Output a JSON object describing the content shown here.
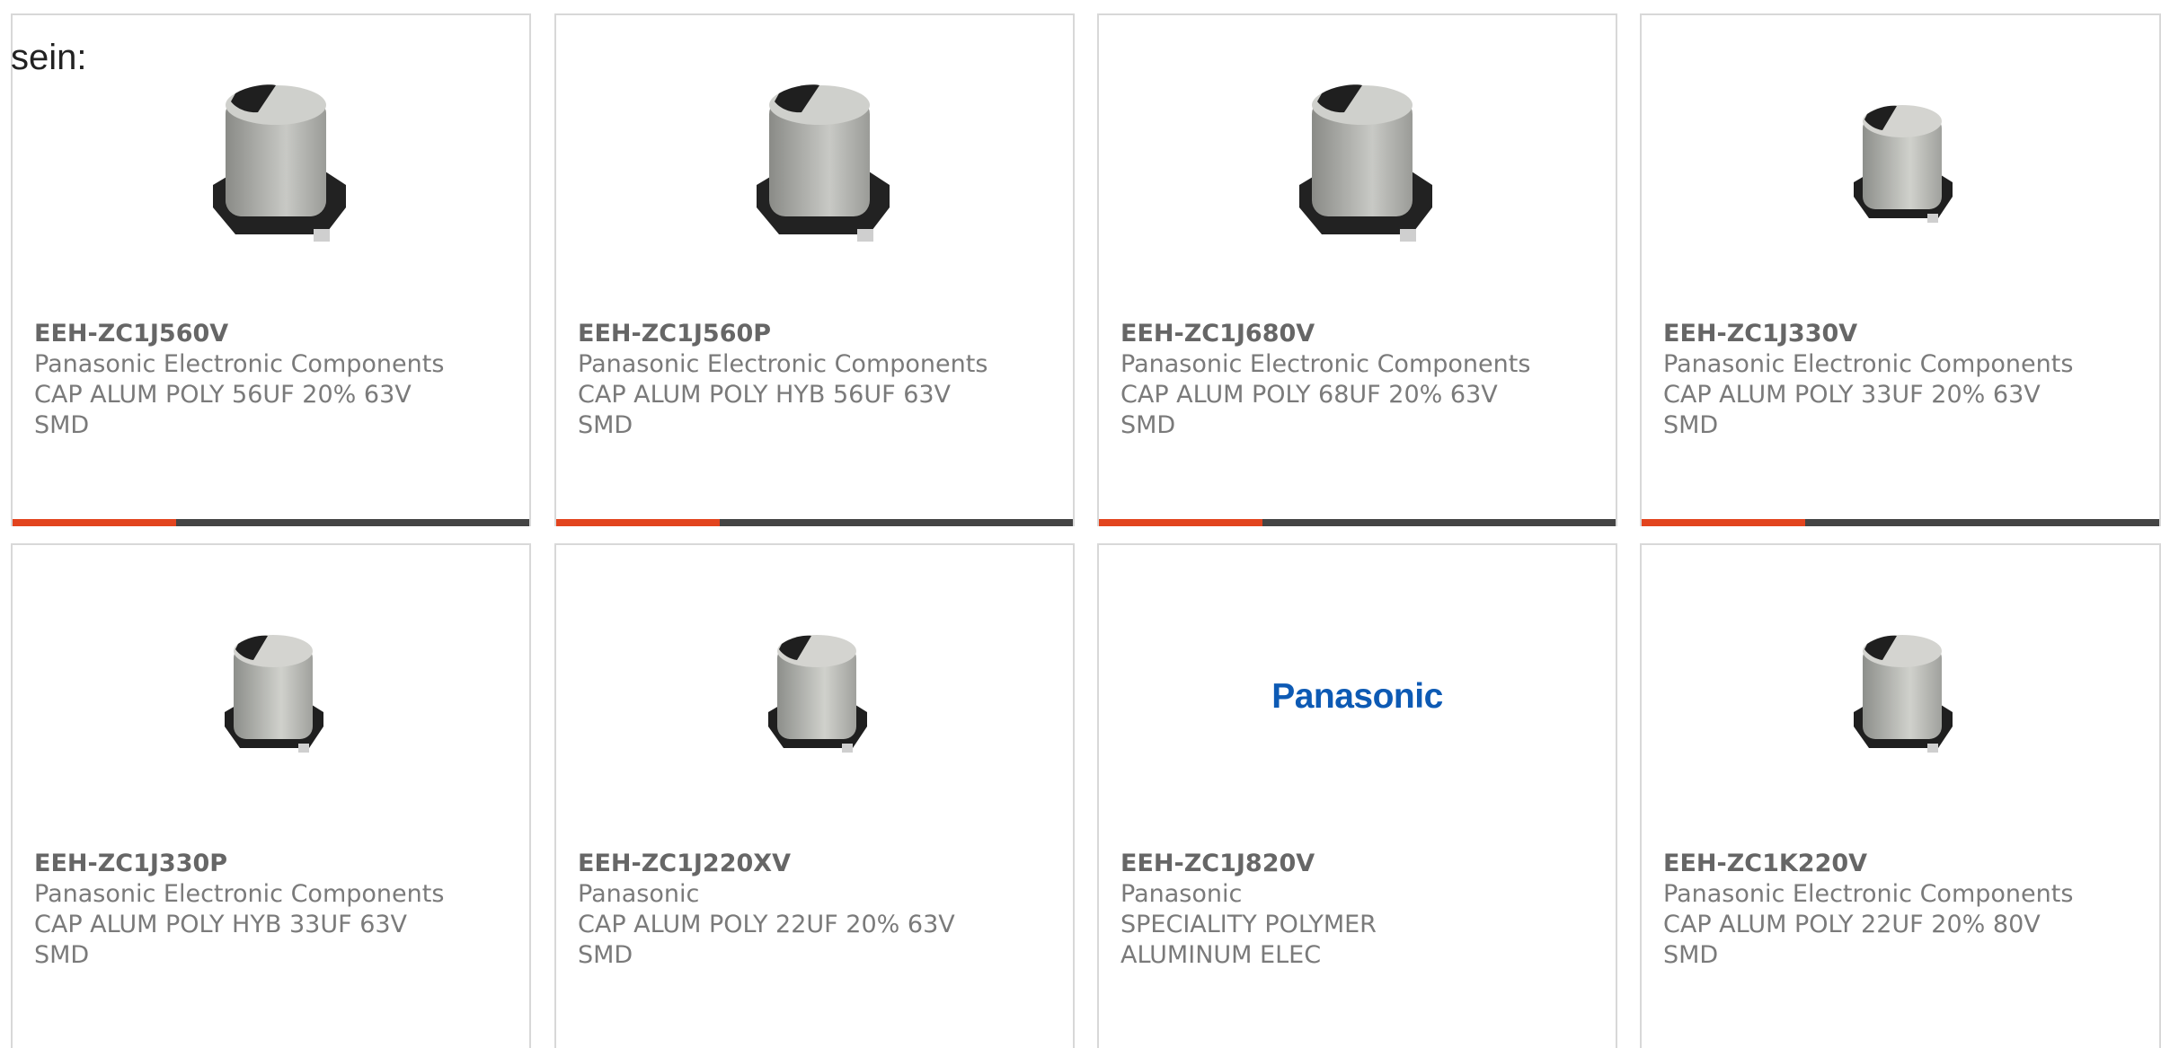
{
  "intro_text": "sein:",
  "products": [
    {
      "part_number": "EEH-ZC1J560V",
      "manufacturer": "Panasonic Electronic Components",
      "description_line_1": "CAP ALUM POLY 56UF 20% 63V",
      "description_line_2": "SMD",
      "image_kind": "capacitor-large",
      "has_accent_bar": true
    },
    {
      "part_number": "EEH-ZC1J560P",
      "manufacturer": "Panasonic Electronic Components",
      "description_line_1": "CAP ALUM POLY HYB 56UF 63V",
      "description_line_2": "SMD",
      "image_kind": "capacitor-large",
      "has_accent_bar": true
    },
    {
      "part_number": "EEH-ZC1J680V",
      "manufacturer": "Panasonic Electronic Components",
      "description_line_1": "CAP ALUM POLY 68UF 20% 63V",
      "description_line_2": "SMD",
      "image_kind": "capacitor-large",
      "has_accent_bar": true
    },
    {
      "part_number": "EEH-ZC1J330V",
      "manufacturer": "Panasonic Electronic Components",
      "description_line_1": "CAP ALUM POLY 33UF 20% 63V",
      "description_line_2": "SMD",
      "image_kind": "capacitor-small",
      "has_accent_bar": true
    },
    {
      "part_number": "EEH-ZC1J330P",
      "manufacturer": "Panasonic Electronic Components",
      "description_line_1": "CAP ALUM POLY HYB 33UF 63V",
      "description_line_2": "SMD",
      "image_kind": "capacitor-small",
      "has_accent_bar": false
    },
    {
      "part_number": "EEH-ZC1J220XV",
      "manufacturer": "Panasonic",
      "description_line_1": "CAP ALUM POLY 22UF 20% 63V",
      "description_line_2": "SMD",
      "image_kind": "capacitor-small",
      "has_accent_bar": false
    },
    {
      "part_number": "EEH-ZC1J820V",
      "manufacturer": "Panasonic",
      "description_line_1": "SPECIALITY POLYMER",
      "description_line_2": "ALUMINUM ELEC",
      "image_kind": "brand-logo",
      "image_text": "Panasonic",
      "has_accent_bar": false
    },
    {
      "part_number": "EEH-ZC1K220V",
      "manufacturer": "Panasonic Electronic Components",
      "description_line_1": "CAP ALUM POLY 22UF 20% 80V",
      "description_line_2": "SMD",
      "image_kind": "capacitor-small",
      "has_accent_bar": false
    }
  ],
  "colors": {
    "accent": "#e2441e",
    "bar_dark": "#444444",
    "card_border": "#d8d8d8",
    "text_muted": "#7a7a7a",
    "logo_blue": "#0d5ab4"
  }
}
